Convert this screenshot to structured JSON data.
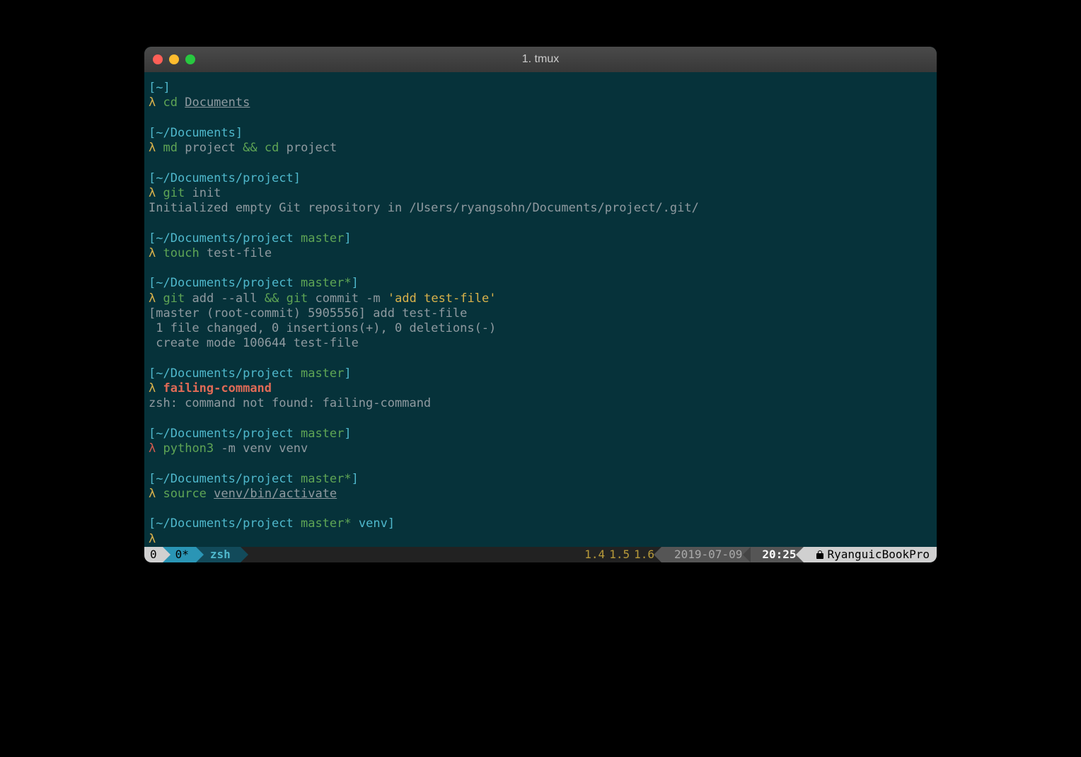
{
  "window": {
    "title": "1. tmux"
  },
  "prompts": {
    "p1": {
      "path": "~",
      "cmd": "cd",
      "arg_underlined": "Documents"
    },
    "p2": {
      "path": "~/Documents",
      "cmd1": "md",
      "arg1": "project",
      "amp": "&&",
      "cmd2": "cd",
      "arg2": "project"
    },
    "p3": {
      "path": "~/Documents/project",
      "cmd": "git",
      "arg": "init",
      "out": "Initialized empty Git repository in /Users/ryangsohn/Documents/project/.git/"
    },
    "p4": {
      "path": "~/Documents/project",
      "branch": "master",
      "cmd": "touch",
      "arg": "test-file"
    },
    "p5": {
      "path": "~/Documents/project",
      "branch": "master*",
      "cmd1": "git",
      "arg1": "add --all",
      "amp": "&&",
      "cmd2": "git",
      "arg2": "commit -m",
      "msg": "'add test-file'",
      "out1": "[master (root-commit) 5905556] add test-file",
      "out2": " 1 file changed, 0 insertions(+), 0 deletions(-)",
      "out3": " create mode 100644 test-file"
    },
    "p6": {
      "path": "~/Documents/project",
      "branch": "master",
      "cmd": "failing-command",
      "out": "zsh: command not found: failing-command"
    },
    "p7": {
      "path": "~/Documents/project",
      "branch": "master",
      "cmd": "python3",
      "arg": "-m venv venv"
    },
    "p8": {
      "path": "~/Documents/project",
      "branch": "master*",
      "cmd": "source",
      "arg_underlined": "venv/bin/activate"
    },
    "p9": {
      "path": "~/Documents/project",
      "branch": "master*",
      "venv": "venv"
    }
  },
  "glyph": {
    "lambda": "λ",
    "lbrack": "[",
    "rbrack": "]"
  },
  "statusbar": {
    "session": "0",
    "window": "0*",
    "pane": "zsh",
    "load1": "1.4",
    "load2": "1.5",
    "load3": "1.6",
    "date": "2019-07-09",
    "time": "20:25",
    "host": "RyanguicBookPro"
  }
}
